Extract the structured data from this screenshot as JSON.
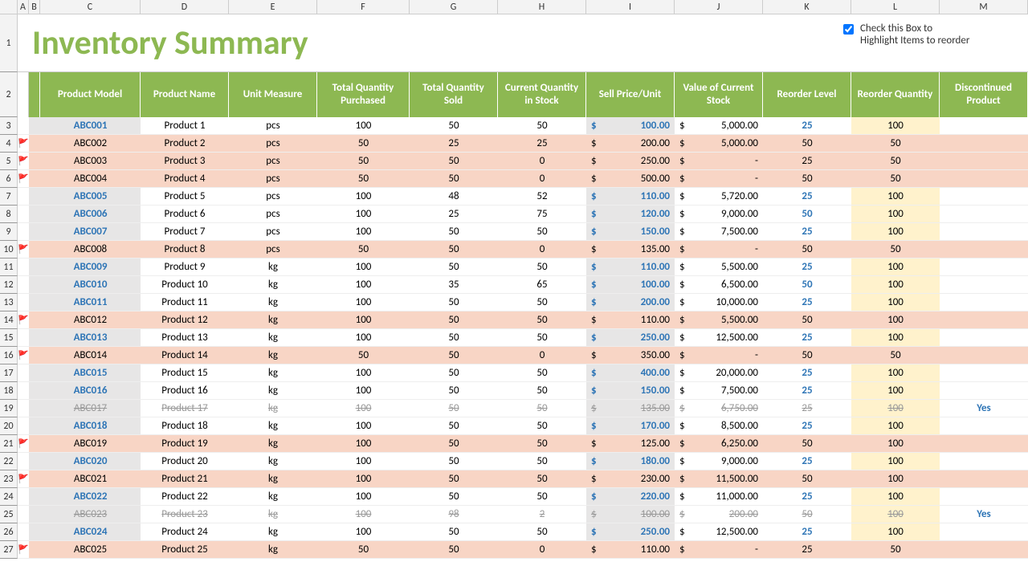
{
  "title": "Inventory Summary",
  "checkbox_label": "Check this Box to Highlight Items to reorder",
  "cols": [
    "A",
    "B",
    "C",
    "D",
    "E",
    "F",
    "G",
    "H",
    "I",
    "J",
    "K",
    "L",
    "M"
  ],
  "headers": [
    "Product Model",
    "Product Name",
    "Unit Measure",
    "Total Quantity Purchased",
    "Total Quantity Sold",
    "Current Quantity in Stock",
    "Sell Price/Unit",
    "Value of Current Stock",
    "Reorder Level",
    "Reorder Quantity",
    "Discontinued Product"
  ],
  "rows": [
    {
      "r": 3,
      "flag": false,
      "hl": true,
      "link": true,
      "model": "ABC001",
      "name": "Product 1",
      "unit": "pcs",
      "purch": "100",
      "sold": "50",
      "stock": "50",
      "price": "100.00",
      "value": "5,000.00",
      "reorder": "25",
      "rq": "100",
      "disc": "",
      "strike": false,
      "priceBlue": true,
      "reBlue": true
    },
    {
      "r": 4,
      "flag": true,
      "hl": false,
      "link": false,
      "model": "ABC002",
      "name": "Product 2",
      "unit": "pcs",
      "purch": "50",
      "sold": "25",
      "stock": "25",
      "price": "200.00",
      "value": "5,000.00",
      "reorder": "50",
      "rq": "50",
      "disc": "",
      "strike": false,
      "priceBlue": false,
      "reBlue": false
    },
    {
      "r": 5,
      "flag": true,
      "hl": false,
      "link": false,
      "model": "ABC003",
      "name": "Product 3",
      "unit": "pcs",
      "purch": "50",
      "sold": "50",
      "stock": "0",
      "price": "250.00",
      "value": "-",
      "reorder": "25",
      "rq": "50",
      "disc": "",
      "strike": false,
      "priceBlue": false,
      "reBlue": false
    },
    {
      "r": 6,
      "flag": true,
      "hl": false,
      "link": false,
      "model": "ABC004",
      "name": "Product 4",
      "unit": "pcs",
      "purch": "50",
      "sold": "50",
      "stock": "0",
      "price": "500.00",
      "value": "-",
      "reorder": "50",
      "rq": "50",
      "disc": "",
      "strike": false,
      "priceBlue": false,
      "reBlue": false
    },
    {
      "r": 7,
      "flag": false,
      "hl": true,
      "link": true,
      "model": "ABC005",
      "name": "Product 5",
      "unit": "pcs",
      "purch": "100",
      "sold": "48",
      "stock": "52",
      "price": "110.00",
      "value": "5,720.00",
      "reorder": "25",
      "rq": "100",
      "disc": "",
      "strike": false,
      "priceBlue": true,
      "reBlue": true
    },
    {
      "r": 8,
      "flag": false,
      "hl": true,
      "link": true,
      "model": "ABC006",
      "name": "Product 6",
      "unit": "pcs",
      "purch": "100",
      "sold": "25",
      "stock": "75",
      "price": "120.00",
      "value": "9,000.00",
      "reorder": "50",
      "rq": "100",
      "disc": "",
      "strike": false,
      "priceBlue": true,
      "reBlue": true
    },
    {
      "r": 9,
      "flag": false,
      "hl": true,
      "link": true,
      "model": "ABC007",
      "name": "Product 7",
      "unit": "pcs",
      "purch": "100",
      "sold": "50",
      "stock": "50",
      "price": "150.00",
      "value": "7,500.00",
      "reorder": "25",
      "rq": "100",
      "disc": "",
      "strike": false,
      "priceBlue": true,
      "reBlue": true
    },
    {
      "r": 10,
      "flag": true,
      "hl": false,
      "link": false,
      "model": "ABC008",
      "name": "Product 8",
      "unit": "pcs",
      "purch": "50",
      "sold": "50",
      "stock": "0",
      "price": "135.00",
      "value": "-",
      "reorder": "50",
      "rq": "50",
      "disc": "",
      "strike": false,
      "priceBlue": false,
      "reBlue": false
    },
    {
      "r": 11,
      "flag": false,
      "hl": true,
      "link": true,
      "model": "ABC009",
      "name": "Product 9",
      "unit": "kg",
      "purch": "100",
      "sold": "50",
      "stock": "50",
      "price": "110.00",
      "value": "5,500.00",
      "reorder": "25",
      "rq": "100",
      "disc": "",
      "strike": false,
      "priceBlue": true,
      "reBlue": true
    },
    {
      "r": 12,
      "flag": false,
      "hl": true,
      "link": true,
      "model": "ABC010",
      "name": "Product 10",
      "unit": "kg",
      "purch": "100",
      "sold": "35",
      "stock": "65",
      "price": "100.00",
      "value": "6,500.00",
      "reorder": "50",
      "rq": "100",
      "disc": "",
      "strike": false,
      "priceBlue": true,
      "reBlue": true
    },
    {
      "r": 13,
      "flag": false,
      "hl": true,
      "link": true,
      "model": "ABC011",
      "name": "Product 11",
      "unit": "kg",
      "purch": "100",
      "sold": "50",
      "stock": "50",
      "price": "200.00",
      "value": "10,000.00",
      "reorder": "25",
      "rq": "100",
      "disc": "",
      "strike": false,
      "priceBlue": true,
      "reBlue": true
    },
    {
      "r": 14,
      "flag": true,
      "hl": false,
      "link": false,
      "model": "ABC012",
      "name": "Product 12",
      "unit": "kg",
      "purch": "100",
      "sold": "50",
      "stock": "50",
      "price": "110.00",
      "value": "5,500.00",
      "reorder": "50",
      "rq": "100",
      "disc": "",
      "strike": false,
      "priceBlue": false,
      "reBlue": false
    },
    {
      "r": 15,
      "flag": false,
      "hl": true,
      "link": true,
      "model": "ABC013",
      "name": "Product 13",
      "unit": "kg",
      "purch": "100",
      "sold": "50",
      "stock": "50",
      "price": "250.00",
      "value": "12,500.00",
      "reorder": "25",
      "rq": "100",
      "disc": "",
      "strike": false,
      "priceBlue": true,
      "reBlue": true
    },
    {
      "r": 16,
      "flag": true,
      "hl": false,
      "link": false,
      "model": "ABC014",
      "name": "Product 14",
      "unit": "kg",
      "purch": "50",
      "sold": "50",
      "stock": "0",
      "price": "350.00",
      "value": "-",
      "reorder": "50",
      "rq": "50",
      "disc": "",
      "strike": false,
      "priceBlue": false,
      "reBlue": false
    },
    {
      "r": 17,
      "flag": false,
      "hl": true,
      "link": true,
      "model": "ABC015",
      "name": "Product 15",
      "unit": "kg",
      "purch": "100",
      "sold": "50",
      "stock": "50",
      "price": "400.00",
      "value": "20,000.00",
      "reorder": "25",
      "rq": "100",
      "disc": "",
      "strike": false,
      "priceBlue": true,
      "reBlue": true
    },
    {
      "r": 18,
      "flag": false,
      "hl": true,
      "link": true,
      "model": "ABC016",
      "name": "Product 16",
      "unit": "kg",
      "purch": "100",
      "sold": "50",
      "stock": "50",
      "price": "150.00",
      "value": "7,500.00",
      "reorder": "25",
      "rq": "100",
      "disc": "",
      "strike": false,
      "priceBlue": true,
      "reBlue": true
    },
    {
      "r": 19,
      "flag": false,
      "hl": true,
      "link": false,
      "model": "ABC017",
      "name": "Product 17",
      "unit": "kg",
      "purch": "100",
      "sold": "50",
      "stock": "50",
      "price": "135.00",
      "value": "6,750.00",
      "reorder": "25",
      "rq": "100",
      "disc": "Yes",
      "strike": true,
      "priceBlue": false,
      "reBlue": false
    },
    {
      "r": 20,
      "flag": false,
      "hl": true,
      "link": true,
      "model": "ABC018",
      "name": "Product 18",
      "unit": "kg",
      "purch": "100",
      "sold": "50",
      "stock": "50",
      "price": "170.00",
      "value": "8,500.00",
      "reorder": "25",
      "rq": "100",
      "disc": "",
      "strike": false,
      "priceBlue": true,
      "reBlue": true
    },
    {
      "r": 21,
      "flag": true,
      "hl": false,
      "link": false,
      "model": "ABC019",
      "name": "Product 19",
      "unit": "kg",
      "purch": "100",
      "sold": "50",
      "stock": "50",
      "price": "125.00",
      "value": "6,250.00",
      "reorder": "50",
      "rq": "100",
      "disc": "",
      "strike": false,
      "priceBlue": false,
      "reBlue": false
    },
    {
      "r": 22,
      "flag": false,
      "hl": true,
      "link": true,
      "model": "ABC020",
      "name": "Product 20",
      "unit": "kg",
      "purch": "100",
      "sold": "50",
      "stock": "50",
      "price": "180.00",
      "value": "9,000.00",
      "reorder": "25",
      "rq": "100",
      "disc": "",
      "strike": false,
      "priceBlue": true,
      "reBlue": true
    },
    {
      "r": 23,
      "flag": true,
      "hl": false,
      "link": false,
      "model": "ABC021",
      "name": "Product 21",
      "unit": "kg",
      "purch": "100",
      "sold": "50",
      "stock": "50",
      "price": "230.00",
      "value": "11,500.00",
      "reorder": "50",
      "rq": "100",
      "disc": "",
      "strike": false,
      "priceBlue": false,
      "reBlue": false
    },
    {
      "r": 24,
      "flag": false,
      "hl": true,
      "link": true,
      "model": "ABC022",
      "name": "Product 22",
      "unit": "kg",
      "purch": "100",
      "sold": "50",
      "stock": "50",
      "price": "220.00",
      "value": "11,000.00",
      "reorder": "25",
      "rq": "100",
      "disc": "",
      "strike": false,
      "priceBlue": true,
      "reBlue": true
    },
    {
      "r": 25,
      "flag": false,
      "hl": true,
      "link": false,
      "model": "ABC023",
      "name": "Product 23",
      "unit": "kg",
      "purch": "100",
      "sold": "98",
      "stock": "2",
      "price": "100.00",
      "value": "200.00",
      "reorder": "50",
      "rq": "100",
      "disc": "Yes",
      "strike": true,
      "priceBlue": false,
      "reBlue": false
    },
    {
      "r": 26,
      "flag": false,
      "hl": true,
      "link": true,
      "model": "ABC024",
      "name": "Product 24",
      "unit": "kg",
      "purch": "100",
      "sold": "50",
      "stock": "50",
      "price": "250.00",
      "value": "12,500.00",
      "reorder": "25",
      "rq": "100",
      "disc": "",
      "strike": false,
      "priceBlue": true,
      "reBlue": true
    },
    {
      "r": 27,
      "flag": true,
      "hl": false,
      "link": false,
      "model": "ABC025",
      "name": "Product 25",
      "unit": "kg",
      "purch": "50",
      "sold": "50",
      "stock": "0",
      "price": "110.00",
      "value": "-",
      "reorder": "25",
      "rq": "50",
      "disc": "",
      "strike": false,
      "priceBlue": false,
      "reBlue": false
    }
  ]
}
